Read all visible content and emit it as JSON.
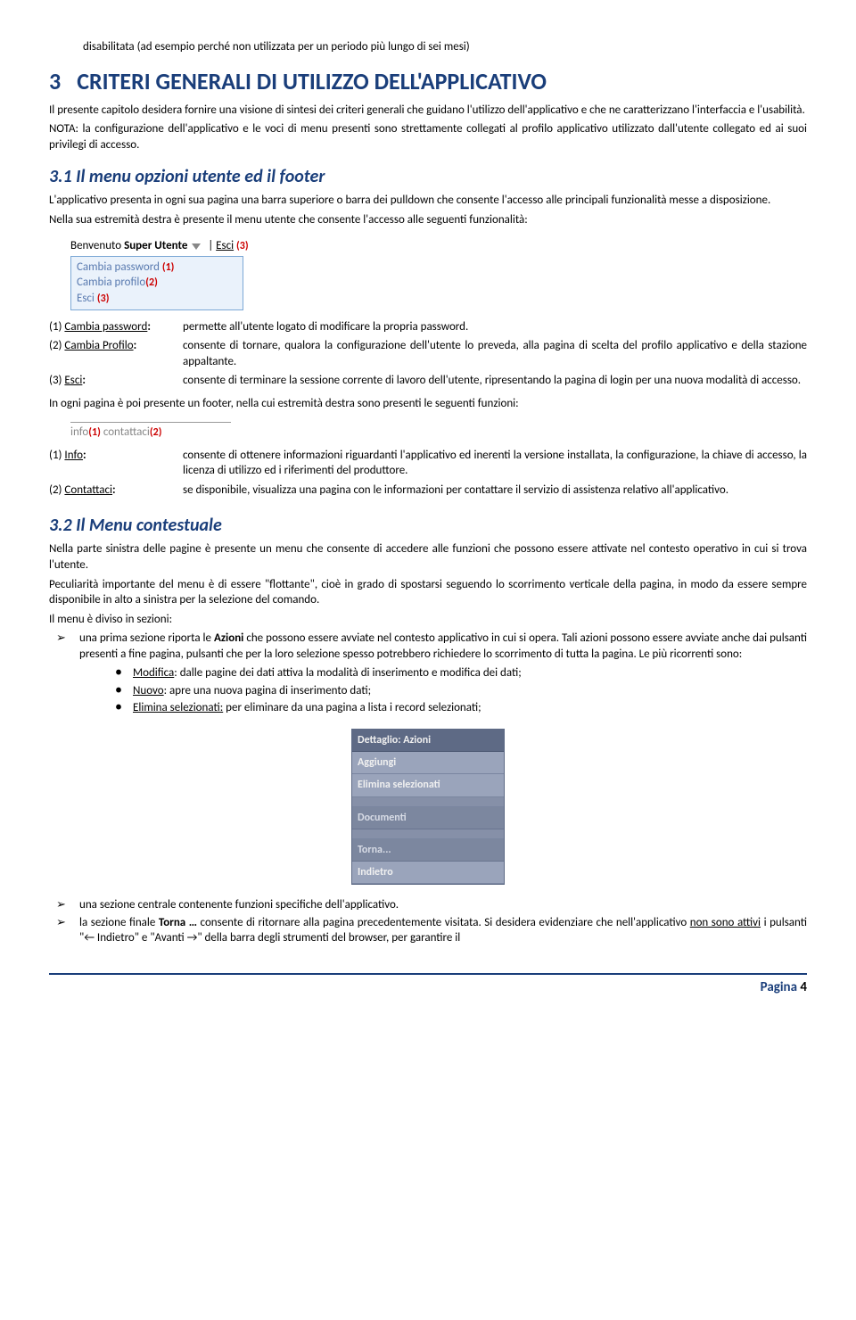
{
  "orphan": "disabilitata (ad esempio perché non utilizzata per un periodo più lungo di sei mesi)",
  "h1": {
    "num": "3",
    "text": "CRITERI GENERALI DI UTILIZZO DELL'APPLICATIVO"
  },
  "p1": "Il presente capitolo desidera fornire una visione di sintesi dei criteri generali che guidano l'utilizzo dell'applicativo e che ne caratterizzano l'interfaccia e l'usabilità.",
  "p2": "NOTA: la configurazione dell'applicativo e le voci di menu presenti sono strettamente collegati al profilo applicativo utilizzato dall'utente collegato ed ai suoi privilegi di accesso.",
  "h2a": "3.1   Il menu opzioni utente ed il footer",
  "p3": "L'applicativo presenta in ogni sua pagina una barra superiore o barra dei pulldown che consente l'accesso alle principali funzionalità messe a disposizione.",
  "p4": "Nella sua estremità destra è presente il menu utente che consente l'accesso alle seguenti funzionalità:",
  "usermenu": {
    "welcome_pre": "Benvenuto ",
    "welcome_name": "Super Utente",
    "esci_top": "Esci",
    "n3": "(3)",
    "row1": "Cambia password",
    "n1": "(1)",
    "row2": "Cambia profilo",
    "n2": "(2)",
    "row3": "Esci",
    "n3b": "(3)"
  },
  "defs1": [
    {
      "k_pre": "(1) ",
      "k": "Cambia password",
      "k_post": ":",
      "v": "permette all'utente logato di modificare la propria password."
    },
    {
      "k_pre": "(2) ",
      "k": "Cambia Profilo",
      "k_post": ":",
      "v": "consente di tornare, qualora la configurazione dell'utente lo preveda, alla pagina di scelta del profilo applicativo e della stazione appaltante."
    },
    {
      "k_pre": "(3) ",
      "k": "Esci",
      "k_post": ":",
      "v": "consente di terminare la sessione corrente di lavoro dell'utente, ripresentando la pagina di login per una nuova modalità di accesso."
    }
  ],
  "p5": "In ogni pagina è poi presente un footer, nella cui estremità destra sono presenti le seguenti funzioni:",
  "footerimg": {
    "info": "info",
    "n1": "(1)",
    "sep": " . ",
    "cont": "contattaci",
    "n2": "(2)"
  },
  "defs2": [
    {
      "k_pre": "(1) ",
      "k": "Info",
      "k_post": ":",
      "v": "consente di ottenere informazioni riguardanti l'applicativo ed inerenti la versione installata, la configurazione, la chiave di accesso, la licenza di utilizzo ed i riferimenti del produttore."
    },
    {
      "k_pre": "(2) ",
      "k": "Contattaci",
      "k_post": ":",
      "v": "se disponibile, visualizza una pagina con le informazioni per contattare il servizio di assistenza relativo all'applicativo."
    }
  ],
  "h2b": "3.2   Il Menu contestuale",
  "p6": "Nella parte sinistra delle pagine è presente un menu che consente di accedere alle funzioni che possono essere attivate nel contesto operativo in cui si trova l'utente.",
  "p7": "Peculiarità importante del menu è di essere \"flottante\", cioè in grado di spostarsi seguendo lo scorrimento verticale della pagina, in modo da essere sempre disponibile in alto a sinistra per la selezione del comando.",
  "p8": "Il menu è diviso in sezioni:",
  "arrow1_pre": "una prima sezione riporta le ",
  "arrow1_bold": "Azioni",
  "arrow1_post": " che possono essere avviate nel contesto applicativo in cui si opera. Tali azioni possono essere avviate anche dai pulsanti presenti a fine pagina, pulsanti che per la loro selezione spesso potrebbero richiedere lo scorrimento di tutta la pagina. Le più ricorrenti sono:",
  "bullets": [
    {
      "u": "Modifica",
      "rest": ": dalle pagine dei dati attiva la modalità di inserimento e modifica dei dati;"
    },
    {
      "u": "Nuovo",
      "rest": ": apre una nuova pagina di inserimento dati;"
    },
    {
      "u": "Elimina selezionati:",
      "rest": " per eliminare da una pagina a lista i record selezionati;"
    }
  ],
  "ctx": {
    "header": "Dettaglio: Azioni",
    "i1": "Aggiungi",
    "i2": "Elimina selezionati",
    "s1": "Documenti",
    "s2": "Torna...",
    "i3": "Indietro"
  },
  "arrow2": "una sezione centrale contenente funzioni specifiche dell'applicativo.",
  "arrow3_pre": "la sezione finale ",
  "arrow3_b1": "Torna …",
  "arrow3_mid1": " consente di ritornare alla pagina precedentemente visitata. Si desidera evidenziare che nell'applicativo ",
  "arrow3_u": "non sono attivi",
  "arrow3_mid2": " i pulsanti \"← Indietro\" e \"Avanti →\" della barra degli strumenti del browser, per garantire il",
  "footer": {
    "label": "Pagina ",
    "num": "4"
  }
}
